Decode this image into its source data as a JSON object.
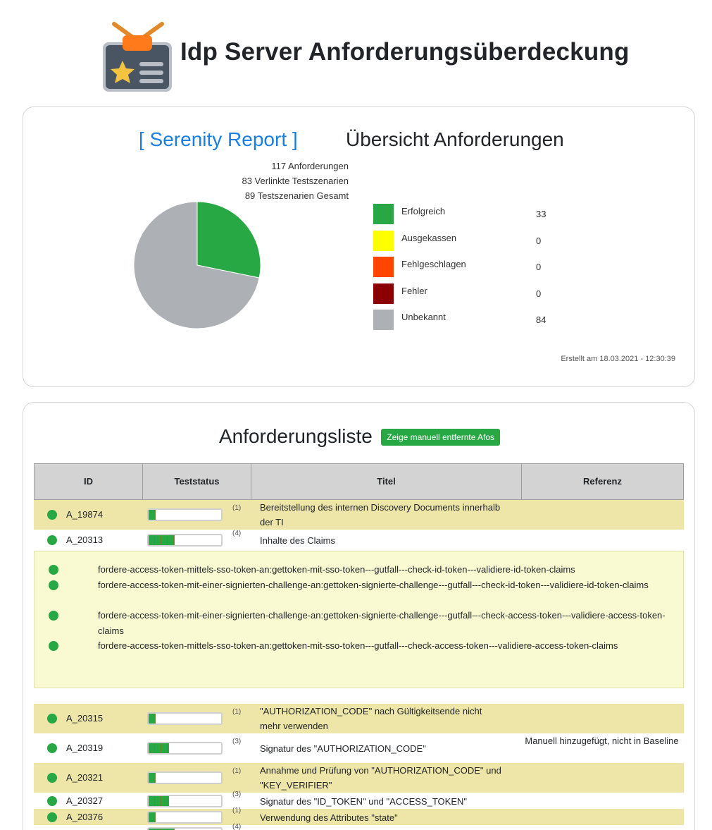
{
  "page": {
    "title": "Idp Server Anforderungsüberdeckung"
  },
  "overview": {
    "serenity_link": "[ Serenity Report ]",
    "title": "Übersicht Anforderungen",
    "stats": {
      "requirements": "117 Anforderungen",
      "linked": "83 Verlinkte Testszenarien",
      "total": "89 Testszenarien Gesamt"
    },
    "legend": [
      {
        "label": "Erfolgreich",
        "value": "33",
        "color": "#28a745"
      },
      {
        "label": "Ausgekassen",
        "value": "0",
        "color": "#ffff00"
      },
      {
        "label": "Fehlgeschlagen",
        "value": "0",
        "color": "#ff4500"
      },
      {
        "label": "Fehler",
        "value": "0",
        "color": "#8b0000"
      },
      {
        "label": "Unbekannt",
        "value": "84",
        "color": "#adb1b6"
      }
    ],
    "created": "Erstellt am 18.03.2021 - 12:30:39"
  },
  "chart_data": {
    "type": "pie",
    "labels": [
      "Erfolgreich",
      "Ausgekassen",
      "Fehlgeschlagen",
      "Fehler",
      "Unbekannt"
    ],
    "values": [
      33,
      0,
      0,
      0,
      84
    ],
    "colors": [
      "#28a745",
      "#ffff00",
      "#ff4500",
      "#8b0000",
      "#adb1b6"
    ]
  },
  "list": {
    "title": "Anforderungsliste",
    "manual_button": "Zeige manuell entfernte Afos",
    "columns": {
      "id": "ID",
      "status": "Teststatus",
      "title": "Titel",
      "ref": "Referenz"
    },
    "rows": [
      {
        "id": "A_19874",
        "count": "(1)",
        "fill": 0.1,
        "title": "Bereitstellung des internen Discovery Documents innerhalb der TI",
        "ref": ""
      },
      {
        "id": "A_20313",
        "count": "(4)",
        "fill": 0.36,
        "title": "Inhalte des Claims",
        "ref": ""
      },
      {
        "id": "A_20315",
        "count": "(1)",
        "fill": 0.1,
        "title": "\"AUTHORIZATION_CODE\" nach Gültigkeitsende nicht mehr verwenden",
        "ref": ""
      },
      {
        "id": "A_20319",
        "count": "(3)",
        "fill": 0.28,
        "title": "Signatur des \"AUTHORIZATION_CODE\"",
        "ref": "Manuell hinzugefügt, nicht in Baseline"
      },
      {
        "id": "A_20321",
        "count": "(1)",
        "fill": 0.1,
        "title": "Annahme und Prüfung von \"AUTHORIZATION_CODE\" und \"KEY_VERIFIER\"",
        "ref": ""
      },
      {
        "id": "A_20327",
        "count": "(3)",
        "fill": 0.28,
        "title": "Signatur des \"ID_TOKEN\" und \"ACCESS_TOKEN\"",
        "ref": ""
      },
      {
        "id": "A_20376",
        "count": "(1)",
        "fill": 0.1,
        "title": "Verwendung des Attributes \"state\"",
        "ref": ""
      },
      {
        "id": "",
        "count": "(4)",
        "fill": 0.36,
        "title": "",
        "ref": ""
      }
    ],
    "scenarios": [
      "fordere-access-token-mittels-sso-token-an:gettoken-mit-sso-token---gutfall---check-id-token---validiere-id-token-claims",
      "fordere-access-token-mit-einer-signierten-challenge-an:gettoken-signierte-challenge---gutfall---check-id-token---validiere-id-token-claims",
      "fordere-access-token-mit-einer-signierten-challenge-an:gettoken-signierte-challenge---gutfall---check-access-token---validiere-access-token-claims",
      "fordere-access-token-mittels-sso-token-an:gettoken-mit-sso-token---gutfall---check-access-token---validiere-access-token-claims"
    ]
  }
}
